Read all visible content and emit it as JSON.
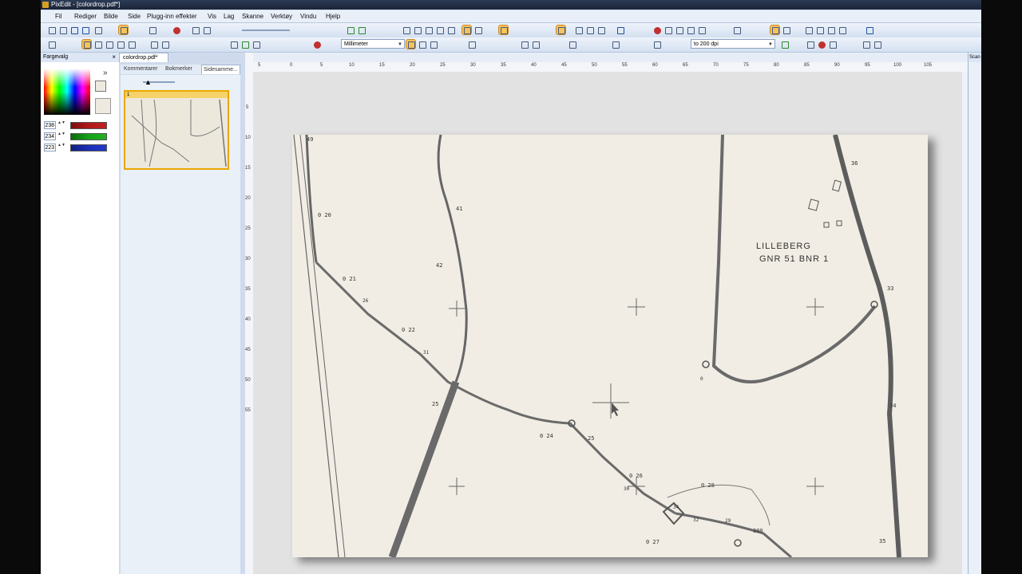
{
  "window": {
    "title": "PixEdit - [colordrop.pdf*]"
  },
  "menu": [
    "Fil",
    "Rediger",
    "Bilde",
    "Side",
    "Plugg-inn effekter",
    "Vis",
    "Lag",
    "Skanne",
    "Verktøy",
    "Vindu",
    "Hjelp"
  ],
  "toolbar": {
    "units": "Millimeter",
    "zoom": "to 200 dpi"
  },
  "color_panel": {
    "title": "Fargevalg",
    "expand": "»",
    "close": "×",
    "red": "238",
    "green": "234",
    "blue": "223",
    "spin": "▲▼",
    "colors": {
      "red_bar": "#b01818",
      "green_bar": "#17a317",
      "blue_bar": "#1b2fb8",
      "current": "#eeeadf"
    }
  },
  "document": {
    "tab": "colordrop.pdf*",
    "subtabs": [
      "Kommentarer",
      "Bokmerker",
      "Sidesamme..."
    ],
    "thumb_number": "1"
  },
  "ruler": {
    "h_ticks": [
      "5",
      "0",
      "5",
      "10",
      "15",
      "20",
      "25",
      "30",
      "35",
      "40",
      "45",
      "50",
      "55",
      "60",
      "65",
      "70",
      "75",
      "80",
      "85",
      "90",
      "95",
      "100",
      "105"
    ],
    "v_ticks": [
      "5",
      "10",
      "15",
      "20",
      "25",
      "30",
      "35",
      "40",
      "45",
      "50",
      "55"
    ]
  },
  "map": {
    "farm_name": "LILLEBERG",
    "farm_id": "GNR 51 BNR 1",
    "labels": [
      "49",
      "0 20",
      "41",
      "42",
      "0 21",
      "26",
      "0 22",
      "31",
      "25",
      "0 24",
      "25",
      "0 26",
      "30",
      "0 28",
      "32",
      "34",
      "29",
      "300",
      "0 27",
      "36",
      "33",
      "34",
      "35",
      "0"
    ]
  },
  "right_panel": {
    "tab": "Scan"
  }
}
